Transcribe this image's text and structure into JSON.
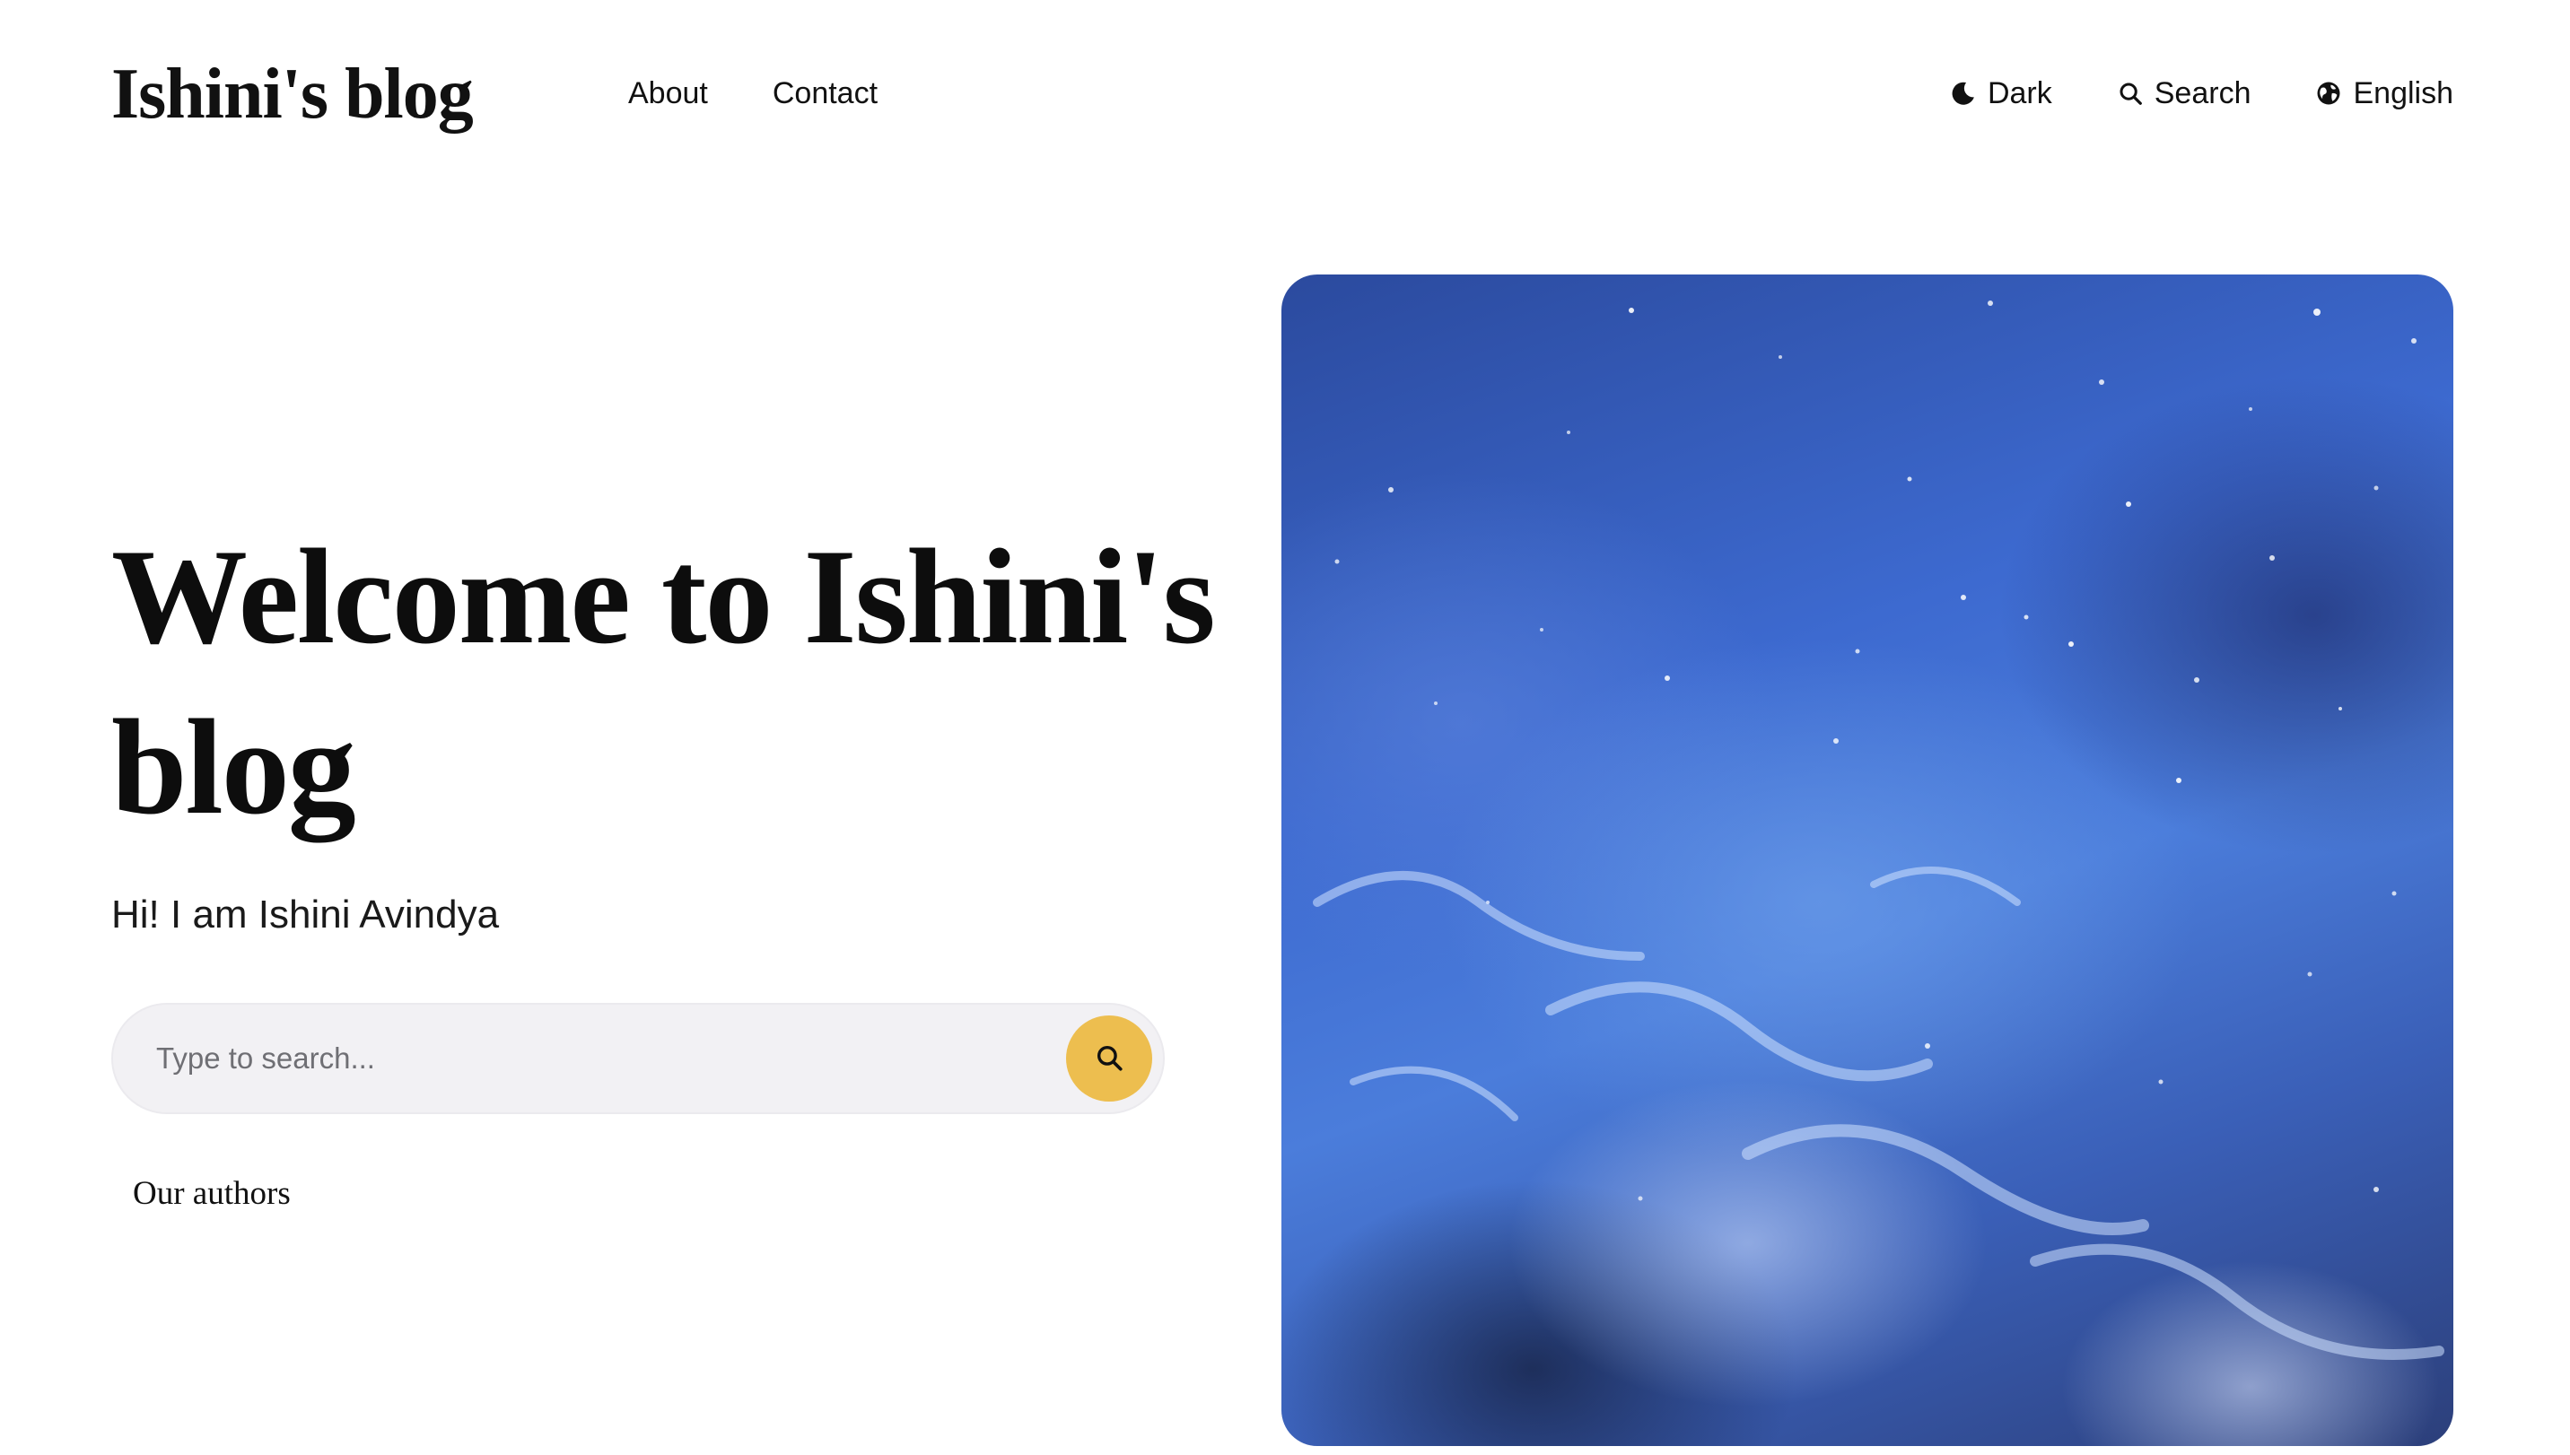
{
  "header": {
    "logo": "Ishini's blog",
    "nav": [
      {
        "label": "About"
      },
      {
        "label": "Contact"
      }
    ],
    "utilities": {
      "theme_label": "Dark",
      "theme_icon": "moon-icon",
      "search_label": "Search",
      "search_icon": "search-icon",
      "language_label": "English",
      "language_icon": "globe-icon"
    }
  },
  "hero": {
    "title": "Welcome to Ishini's blog",
    "subtitle": "Hi! I am Ishini Avindya",
    "search": {
      "placeholder": "Type to search...",
      "value": "",
      "button_icon": "search-icon",
      "button_color": "#edbe4f"
    },
    "authors_label": "Our authors",
    "image": {
      "subject": "blue nebula starfield"
    }
  }
}
